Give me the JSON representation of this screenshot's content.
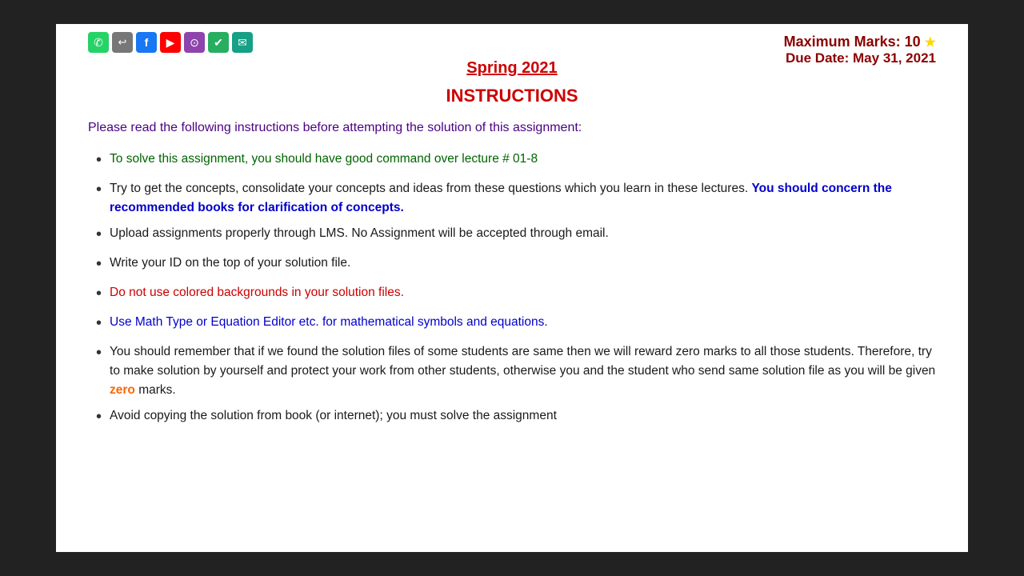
{
  "page": {
    "semester": "Spring 2021",
    "max_marks_label": "Maximum Marks: 10",
    "due_date_label": "Due Date: May 31, 2021",
    "instructions_heading": "INSTRUCTIONS",
    "intro_text_1": "Please read the following instructions before attempting the solution of this assignment:",
    "bullets": [
      {
        "id": 1,
        "text": "To solve this assignment, you should have good command over lecture # 01-8",
        "color": "green"
      },
      {
        "id": 2,
        "text_before": "Try to get the concepts, consolidate your concepts and ideas from these questions which you learn in these lectures. ",
        "text_highlight": "You should concern the recommended books for clarification of concepts.",
        "color": "dark",
        "highlight_color": "blue"
      },
      {
        "id": 3,
        "text": "Upload assignments properly through LMS. No Assignment will be accepted through email.",
        "color": "dark"
      },
      {
        "id": 4,
        "text": "Write your ID on the top of your solution file.",
        "color": "dark"
      },
      {
        "id": 5,
        "text": "Do not use colored backgrounds in your solution files.",
        "color": "red"
      },
      {
        "id": 6,
        "text": "Use Math Type or Equation Editor etc. for mathematical symbols and equations.",
        "color": "blue"
      },
      {
        "id": 7,
        "text_before": "You should remember that if we found the solution files of some students are same then we will reward zero marks to all those students. Therefore, try to make solution by yourself and protect your work from other students, otherwise you and the student who send same solution file as you will be given ",
        "text_highlight": "zero",
        "text_after": " marks.",
        "color": "dark",
        "highlight_color": "orange"
      },
      {
        "id": 8,
        "text": "Avoid copying the solution from book (or internet); you must solve the assignment",
        "color": "dark",
        "cut": true
      }
    ],
    "toolbar": {
      "icons": [
        {
          "name": "whatsapp",
          "symbol": "✆",
          "css": "icon-whatsapp"
        },
        {
          "name": "share",
          "symbol": "↩",
          "css": "icon-share"
        },
        {
          "name": "facebook",
          "symbol": "f",
          "css": "icon-facebook"
        },
        {
          "name": "youtube",
          "symbol": "▶",
          "css": "icon-youtube"
        },
        {
          "name": "circle",
          "symbol": "●",
          "css": "icon-circle-check"
        },
        {
          "name": "shield",
          "symbol": "✔",
          "css": "icon-shield"
        },
        {
          "name": "envelope",
          "symbol": "✉",
          "css": "icon-envelope"
        }
      ]
    }
  }
}
